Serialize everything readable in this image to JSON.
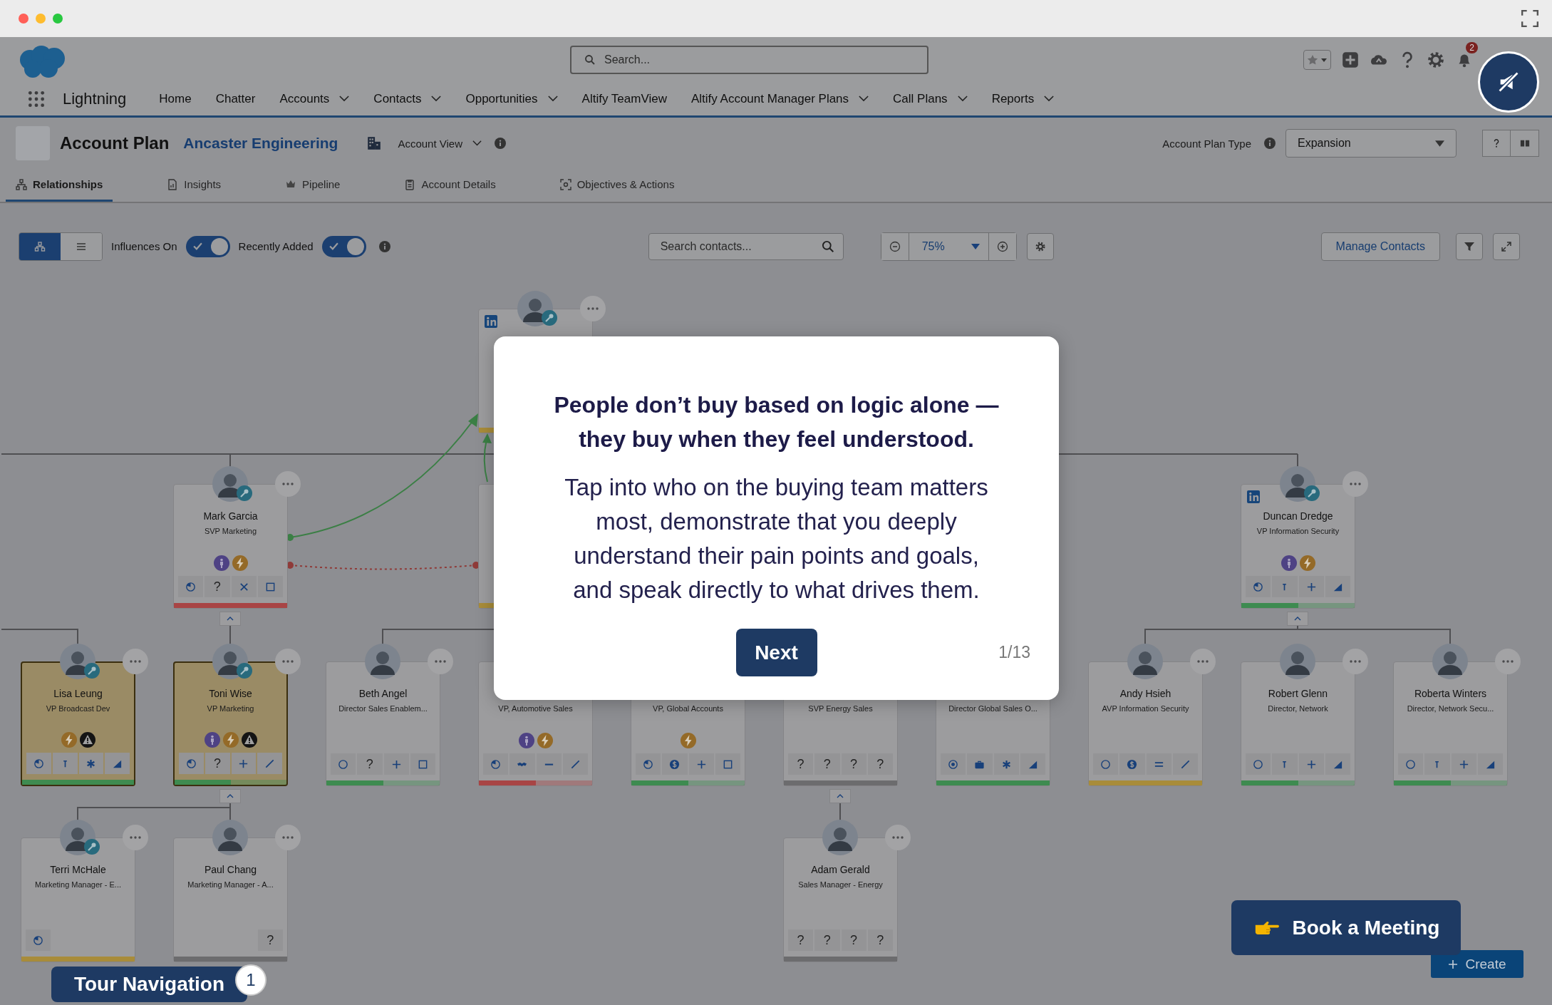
{
  "header": {
    "search": {
      "placeholder": "Search..."
    },
    "notifications": "2",
    "app_name": "Lightning",
    "nav": [
      {
        "label": "Home",
        "has_menu": false
      },
      {
        "label": "Chatter",
        "has_menu": false
      },
      {
        "label": "Accounts",
        "has_menu": true
      },
      {
        "label": "Contacts",
        "has_menu": true
      },
      {
        "label": "Opportunities",
        "has_menu": true
      },
      {
        "label": "Altify TeamView",
        "has_menu": false
      },
      {
        "label": "Altify Account Manager Plans",
        "has_menu": true
      },
      {
        "label": "Call Plans",
        "has_menu": true
      },
      {
        "label": "Reports",
        "has_menu": true
      }
    ]
  },
  "account": {
    "title": "Account Plan",
    "name": "Ancaster Engineering",
    "view": "Account View",
    "plan_type_label": "Account Plan Type",
    "plan_type": "Expansion"
  },
  "tabs": [
    {
      "label": "Relationships",
      "kind": "hierarchy",
      "selected": true
    },
    {
      "label": "Insights",
      "kind": "insights",
      "selected": false
    },
    {
      "label": "Pipeline",
      "kind": "pipeline",
      "selected": false
    },
    {
      "label": "Account Details",
      "kind": "details",
      "selected": false
    },
    {
      "label": "Objectives & Actions",
      "kind": "objectives",
      "selected": false
    }
  ],
  "toolbar": {
    "views": [
      {
        "kind": "chart",
        "selected": true
      },
      {
        "kind": "list",
        "selected": false
      }
    ],
    "toggles": [
      {
        "label": "Influences On",
        "on": true
      },
      {
        "label": "Recently Added",
        "on": true
      }
    ],
    "search": {
      "placeholder": "Search contacts..."
    },
    "zoom": "75%",
    "manage_button": "Manage Contacts"
  },
  "org_chart": {
    "levels": [
      [
        {
          "kind": "gap"
        },
        {
          "kind": "gap"
        },
        {
          "kind": "gap"
        },
        {
          "kind": "contact",
          "photo": true,
          "key": true,
          "linkedin": true,
          "menu": true,
          "highlighted": false,
          "status": {
            "color": "#a88c3a",
            "level": 1
          }
        },
        {
          "kind": "gap"
        },
        {
          "kind": "gap"
        },
        {
          "kind": "gap"
        },
        {
          "kind": "gap"
        },
        {
          "kind": "gap"
        },
        {
          "kind": "gap"
        }
      ],
      [
        {
          "kind": "gap"
        },
        {
          "kind": "contact",
          "name": "Mark Garcia",
          "title": "SVP Marketing",
          "photo": true,
          "key": true,
          "menu": true,
          "highlighted": false,
          "expanded": true,
          "badges": [
            {
              "kind": "influencer"
            },
            {
              "kind": "energy"
            }
          ],
          "actions": [
            {
              "kind": "cycle"
            },
            {
              "kind": "glyph",
              "text": "?"
            },
            {
              "kind": "x"
            },
            {
              "kind": "square"
            }
          ],
          "status": {
            "color": "#a84545",
            "level": 1
          }
        },
        {
          "kind": "gap"
        },
        {
          "kind": "contact",
          "highlighted": false,
          "status": {
            "color": "#a88c3a",
            "level": 1
          }
        },
        {
          "kind": "gap"
        },
        {
          "kind": "gap"
        },
        {
          "kind": "gap"
        },
        {
          "kind": "gap"
        },
        {
          "kind": "contact",
          "name": "Duncan Dredge",
          "title": "VP Information Security",
          "photo": true,
          "key": true,
          "linkedin": true,
          "menu": true,
          "highlighted": false,
          "expanded": true,
          "badges": [
            {
              "kind": "influencer"
            },
            {
              "kind": "energy"
            }
          ],
          "actions": [
            {
              "kind": "cycle"
            },
            {
              "kind": "t"
            },
            {
              "kind": "plus"
            },
            {
              "kind": "triangle"
            }
          ],
          "status": {
            "color": "#3e8b50",
            "level": 0.5
          }
        },
        {
          "kind": "gap"
        }
      ],
      [
        {
          "kind": "contact",
          "name": "Lisa Leung",
          "title": "VP Broadcast Dev",
          "photo": true,
          "key": true,
          "menu": true,
          "highlighted": true,
          "badges": [
            {
              "kind": "energy"
            },
            {
              "kind": "warning"
            }
          ],
          "actions": [
            {
              "kind": "cycle"
            },
            {
              "kind": "t"
            },
            {
              "kind": "asterisk"
            },
            {
              "kind": "triangle"
            }
          ],
          "status": {
            "color": "#3e8b50",
            "level": 1
          }
        },
        {
          "kind": "contact",
          "name": "Toni Wise",
          "title": "VP Marketing",
          "photo": true,
          "key": true,
          "menu": true,
          "highlighted": true,
          "expanded": true,
          "badges": [
            {
              "kind": "influencer"
            },
            {
              "kind": "energy"
            },
            {
              "kind": "warning"
            }
          ],
          "actions": [
            {
              "kind": "cycle"
            },
            {
              "kind": "glyph",
              "text": "?"
            },
            {
              "kind": "plus"
            },
            {
              "kind": "slash"
            }
          ],
          "status": {
            "color": "#3e8b50",
            "level": 0.5
          }
        },
        {
          "kind": "contact",
          "name": "Beth Angel",
          "title": "Director Sales Enablem...",
          "photo": true,
          "menu": true,
          "highlighted": false,
          "actions": [
            {
              "kind": "circle"
            },
            {
              "kind": "glyph",
              "text": "?"
            },
            {
              "kind": "plus"
            },
            {
              "kind": "square"
            }
          ],
          "status": {
            "color": "#3e8b50",
            "level": 0.5
          }
        },
        {
          "kind": "contact",
          "title": "VP, Automotive Sales",
          "highlighted": false,
          "badges": [
            {
              "kind": "influencer"
            },
            {
              "kind": "energy"
            }
          ],
          "actions": [
            {
              "kind": "cycle"
            },
            {
              "kind": "handshake"
            },
            {
              "kind": "minus"
            },
            {
              "kind": "slash"
            }
          ],
          "status": {
            "color": "#a84545",
            "level": 0.5
          }
        },
        {
          "kind": "contact",
          "title": "VP, Global Accounts",
          "highlighted": false,
          "badges": [
            {
              "kind": "energy"
            }
          ],
          "actions": [
            {
              "kind": "cycle"
            },
            {
              "kind": "dollar"
            },
            {
              "kind": "plus"
            },
            {
              "kind": "square"
            }
          ],
          "status": {
            "color": "#3e8b50",
            "level": 0.5
          }
        },
        {
          "kind": "contact",
          "title": "SVP Energy Sales",
          "highlighted": false,
          "expanded": true,
          "actions": [
            {
              "kind": "glyph",
              "text": "?"
            },
            {
              "kind": "glyph",
              "text": "?"
            },
            {
              "kind": "glyph",
              "text": "?"
            },
            {
              "kind": "glyph",
              "text": "?"
            }
          ],
          "status": {
            "color": "#6c6c6e",
            "level": 1
          }
        },
        {
          "kind": "contact",
          "title": "Director Global Sales O...",
          "highlighted": false,
          "actions": [
            {
              "kind": "target"
            },
            {
              "kind": "briefcase"
            },
            {
              "kind": "asterisk"
            },
            {
              "kind": "triangle"
            }
          ],
          "status": {
            "color": "#3e8b50",
            "level": 1
          }
        },
        {
          "kind": "contact",
          "name": "Andy Hsieh",
          "title": "AVP Information Security",
          "photo": true,
          "menu": true,
          "highlighted": false,
          "actions": [
            {
              "kind": "circle"
            },
            {
              "kind": "dollar"
            },
            {
              "kind": "equals"
            },
            {
              "kind": "slash"
            }
          ],
          "status": {
            "color": "#a88c3a",
            "level": 1
          }
        },
        {
          "kind": "contact",
          "name": "Robert Glenn",
          "title": "Director, Network",
          "photo": true,
          "menu": true,
          "highlighted": false,
          "actions": [
            {
              "kind": "circle"
            },
            {
              "kind": "t"
            },
            {
              "kind": "plus"
            },
            {
              "kind": "triangle"
            }
          ],
          "status": {
            "color": "#3e8b50",
            "level": 0.5
          }
        },
        {
          "kind": "contact",
          "name": "Roberta Winters",
          "title": "Director, Network Secu...",
          "photo": true,
          "menu": true,
          "highlighted": false,
          "actions": [
            {
              "kind": "circle"
            },
            {
              "kind": "t"
            },
            {
              "kind": "plus"
            },
            {
              "kind": "triangle"
            }
          ],
          "status": {
            "color": "#3e8b50",
            "level": 0.5
          }
        }
      ],
      [
        {
          "kind": "contact",
          "name": "Terri McHale",
          "title": "Marketing Manager - E...",
          "photo": true,
          "key": true,
          "menu": true,
          "highlighted": false,
          "actions": [
            {
              "kind": "cycle"
            },
            {
              "kind": "blank"
            },
            {
              "kind": "blank"
            },
            {
              "kind": "blank"
            }
          ],
          "status": {
            "color": "#a88c3a",
            "level": 1
          }
        },
        {
          "kind": "contact",
          "name": "Paul Chang",
          "title": "Marketing Manager - A...",
          "photo": true,
          "menu": true,
          "highlighted": false,
          "actions": [
            {
              "kind": "blank"
            },
            {
              "kind": "blank"
            },
            {
              "kind": "blank"
            },
            {
              "kind": "glyph",
              "text": "?"
            }
          ],
          "status": {
            "color": "#6c6c6e",
            "level": 1
          }
        },
        {
          "kind": "gap"
        },
        {
          "kind": "gap"
        },
        {
          "kind": "gap"
        },
        {
          "kind": "contact",
          "name": "Adam Gerald",
          "title": "Sales Manager - Energy",
          "photo": true,
          "menu": true,
          "highlighted": false,
          "actions": [
            {
              "kind": "glyph",
              "text": "?"
            },
            {
              "kind": "glyph",
              "text": "?"
            },
            {
              "kind": "glyph",
              "text": "?"
            },
            {
              "kind": "glyph",
              "text": "?"
            }
          ],
          "status": {
            "color": "#6c6c6e",
            "level": 1
          }
        },
        {
          "kind": "gap"
        },
        {
          "kind": "gap"
        },
        {
          "kind": "gap"
        },
        {
          "kind": "gap"
        }
      ]
    ]
  },
  "tour": {
    "title": "People don’t buy based on logic alone — they buy when they feel understood.",
    "body": "Tap into who on the buying team matters most, demonstrate that you deeply understand their pain points and goals, and speak directly to what drives them.",
    "button": "Next",
    "progress": "1/13"
  },
  "tour_navigation": {
    "label": "Tour Navigation",
    "badge": "1"
  },
  "book_meeting": "Book a Meeting",
  "create_button": "Create"
}
